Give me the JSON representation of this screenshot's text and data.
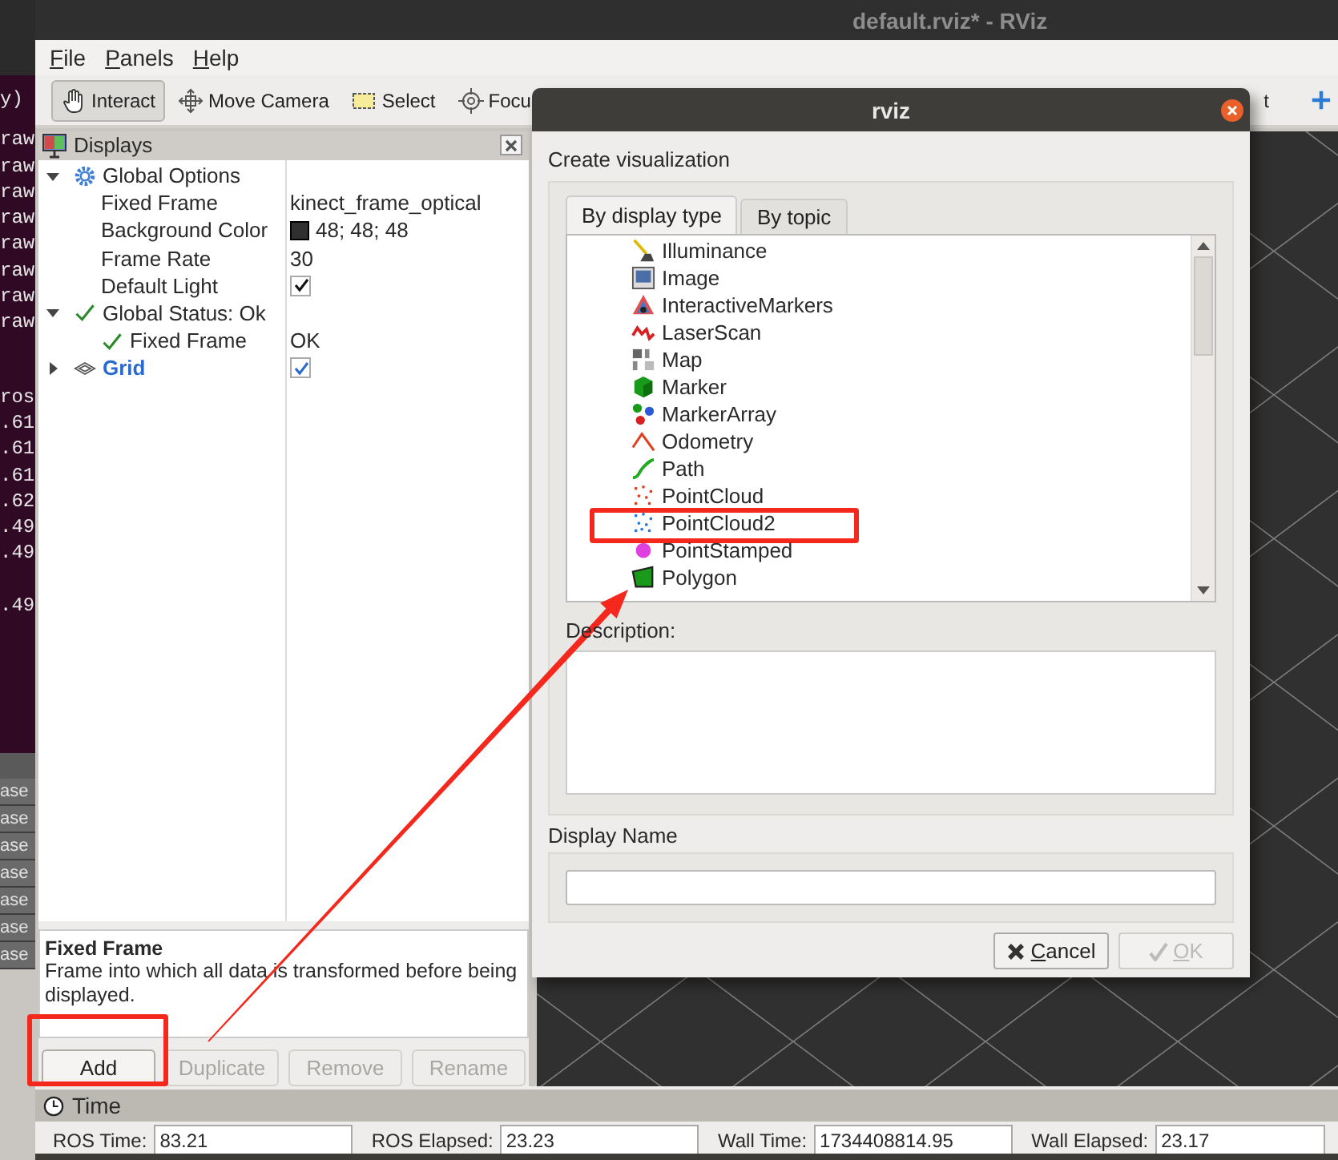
{
  "title_bar": {
    "title": "default.rviz* - RViz"
  },
  "terminal": {
    "groups": [
      {
        "lines": [
          "y)"
        ]
      },
      {
        "lines": [
          "raw",
          "raw",
          "raw",
          "raw",
          "raw",
          "raw",
          "raw",
          "raw"
        ]
      },
      {
        "lines": [
          "ros",
          ".61",
          ".61",
          ".61",
          ".62",
          ".49",
          ".49"
        ]
      },
      {
        "lines": [
          ".49"
        ]
      }
    ],
    "side_tabs": [
      "ase",
      "ase",
      "ase",
      "ase",
      "ase",
      "ase",
      "ase"
    ]
  },
  "menu": [
    {
      "label": "File"
    },
    {
      "label": "Panels"
    },
    {
      "label": "Help"
    }
  ],
  "toolbar": {
    "tools": [
      {
        "label": "Interact",
        "kind": "hand",
        "selected": true
      },
      {
        "label": "Move Camera",
        "kind": "move",
        "selected": false
      },
      {
        "label": "Select",
        "kind": "select",
        "selected": false
      },
      {
        "label": "Focu",
        "kind": "focus",
        "selected": false
      }
    ],
    "right_tool": {
      "label": "t"
    }
  },
  "displays": {
    "title": "Displays",
    "tree": [
      {
        "label": "Global Options",
        "kind": "options",
        "expanded": true,
        "children": [
          {
            "label": "Fixed Frame",
            "kind": "text",
            "value": "kinect_frame_optical"
          },
          {
            "label": "Background Color",
            "kind": "color",
            "color": "#303030",
            "value": "48; 48; 48"
          },
          {
            "label": "Frame Rate",
            "kind": "text",
            "value": "30"
          },
          {
            "label": "Default Light",
            "kind": "checkbox",
            "checked": true
          }
        ]
      },
      {
        "label": "Global Status: Ok",
        "kind": "status",
        "expanded": true,
        "children": [
          {
            "label": "Fixed Frame",
            "kind": "status",
            "value": "OK"
          }
        ]
      },
      {
        "label": "Grid",
        "kind": "display",
        "expanded": false,
        "checked": true
      }
    ],
    "description": {
      "title": "Fixed Frame",
      "text": "Frame into which all data is transformed before being displayed."
    },
    "buttons": [
      {
        "label": "Add",
        "disabled": false
      },
      {
        "label": "Duplicate",
        "disabled": true
      },
      {
        "label": "Remove",
        "disabled": true
      },
      {
        "label": "Rename",
        "disabled": true
      }
    ]
  },
  "dialog": {
    "title": "rviz",
    "heading": "Create visualization",
    "tabs": [
      {
        "label": "By display type",
        "selected": true
      },
      {
        "label": "By topic",
        "selected": false
      }
    ],
    "items": [
      {
        "label": "Illuminance",
        "kind": "illuminance"
      },
      {
        "label": "Image",
        "kind": "image"
      },
      {
        "label": "InteractiveMarkers",
        "kind": "interactive"
      },
      {
        "label": "LaserScan",
        "kind": "laser"
      },
      {
        "label": "Map",
        "kind": "map"
      },
      {
        "label": "Marker",
        "kind": "marker"
      },
      {
        "label": "MarkerArray",
        "kind": "markerarray"
      },
      {
        "label": "Odometry",
        "kind": "odometry"
      },
      {
        "label": "Path",
        "kind": "path"
      },
      {
        "label": "PointCloud",
        "kind": "pointcloud"
      },
      {
        "label": "PointCloud2",
        "kind": "pointcloud2"
      },
      {
        "label": "PointStamped",
        "kind": "pointstamped"
      },
      {
        "label": "Polygon",
        "kind": "polygon"
      }
    ],
    "description_label": "Description:",
    "name_label": "Display Name",
    "buttons": [
      {
        "label": "Cancel",
        "kind": "cancel",
        "disabled": false
      },
      {
        "label": "OK",
        "kind": "ok",
        "disabled": true
      }
    ]
  },
  "time_panel": {
    "title": "Time",
    "fields": [
      {
        "label": "ROS Time:",
        "value": "83.21"
      },
      {
        "label": "ROS Elapsed:",
        "value": "23.23"
      },
      {
        "label": "Wall Time:",
        "value": "1734408814.95"
      },
      {
        "label": "Wall Elapsed:",
        "value": "23.17"
      }
    ]
  }
}
